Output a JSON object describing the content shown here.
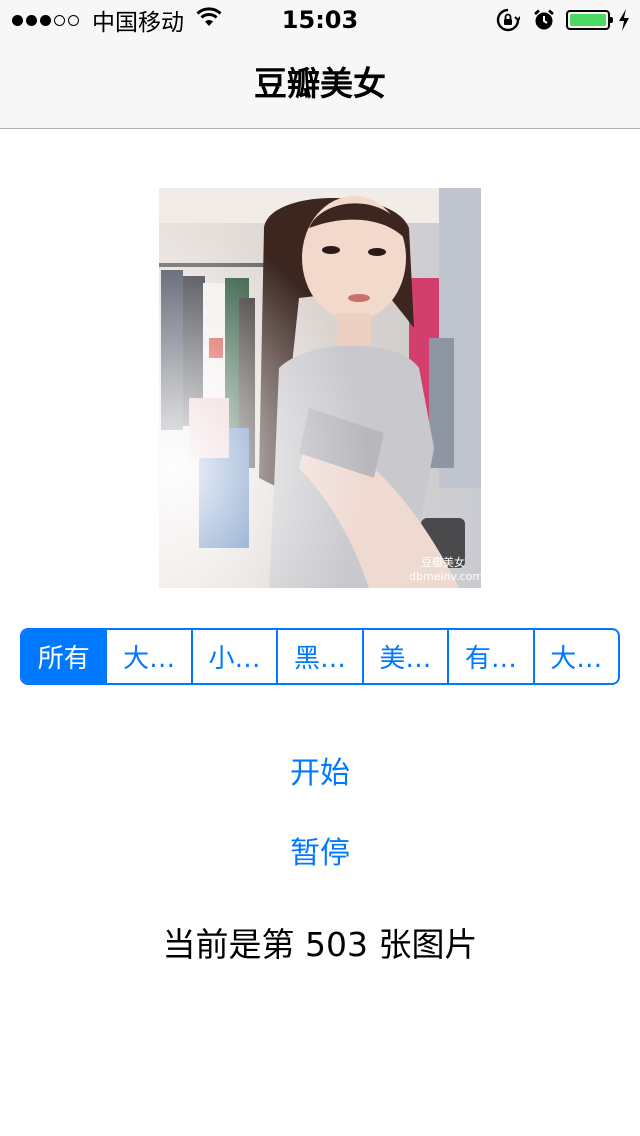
{
  "status_bar": {
    "signal_dots": [
      true,
      true,
      true,
      false,
      false
    ],
    "carrier": "中国移动",
    "time": "15:03",
    "battery_level": 1.0,
    "battery_color": "#4cd964",
    "icons": [
      "wifi-icon",
      "rotation-lock-icon",
      "alarm-icon",
      "battery-icon",
      "charging-icon"
    ]
  },
  "nav": {
    "title": "豆瓣美女"
  },
  "photo": {
    "watermark": "豆瓣美女",
    "watermark_url": "dbmeinv.com"
  },
  "segments": {
    "selected_index": 0,
    "items": [
      "所有",
      "大…",
      "小…",
      "黑…",
      "美…",
      "有…",
      "大…"
    ]
  },
  "actions": {
    "start_label": "开始",
    "pause_label": "暂停"
  },
  "counter_text": "当前是第 503 张图片",
  "colors": {
    "accent": "#0079ff",
    "bar_background": "#f7f7f7"
  }
}
